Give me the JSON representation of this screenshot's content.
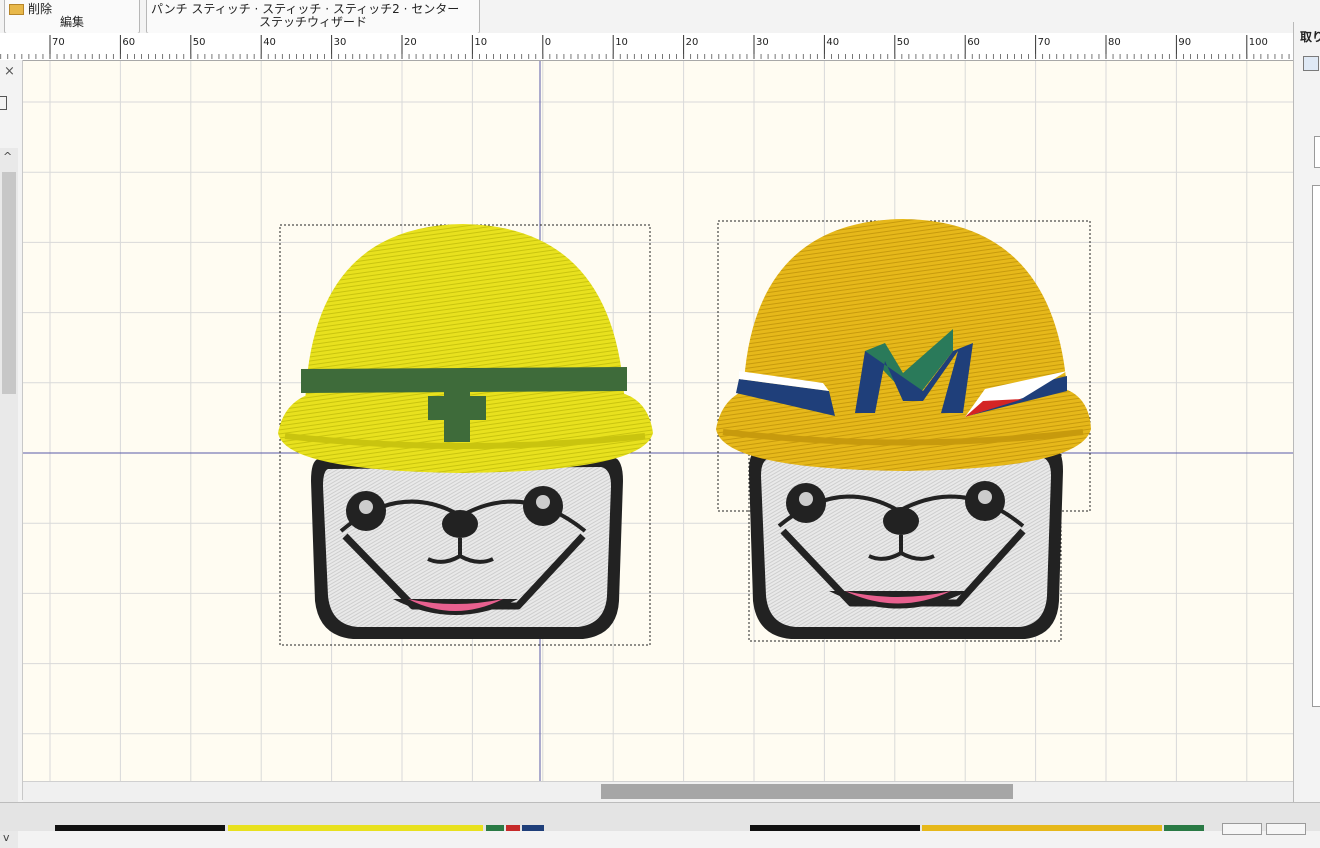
{
  "ribbon": {
    "edit_group": {
      "button_label": "削除",
      "group_label": "編集"
    },
    "stitch_group": {
      "buttons_text": "パンチ スティッチ · スティッチ · スティッチ2 · センター",
      "group_label": "ステッチウィザード"
    }
  },
  "ruler": {
    "ticks": [
      "70",
      "60",
      "50",
      "40",
      "30",
      "20",
      "10",
      "0",
      "10",
      "20",
      "30",
      "40",
      "50",
      "60",
      "70",
      "80",
      "90",
      "100"
    ]
  },
  "right_panel": {
    "title": "取り"
  },
  "left_panel": {
    "close_glyph": "×"
  },
  "scroll": {
    "up_glyph": "^",
    "down_glyph": "v"
  },
  "canvas": {
    "background": "#fffcf2",
    "grid_color": "#d9d9d9",
    "axis_color": "#5a5aa8"
  },
  "designs": [
    {
      "name": "dog-with-yellow-helmet",
      "helmet_color": "#e8e11e",
      "band_color": "#3e6b3a",
      "mark": "cross"
    },
    {
      "name": "dog-with-orange-helmet",
      "helmet_color": "#e6b81a",
      "band_color": "#1f3f7a",
      "mark": "M-logo"
    }
  ],
  "status_swatches": [
    "#111111",
    "#e8e11e",
    "#2a7a45",
    "#c62a2a",
    "#1f3f7a",
    "#e6b81a"
  ]
}
